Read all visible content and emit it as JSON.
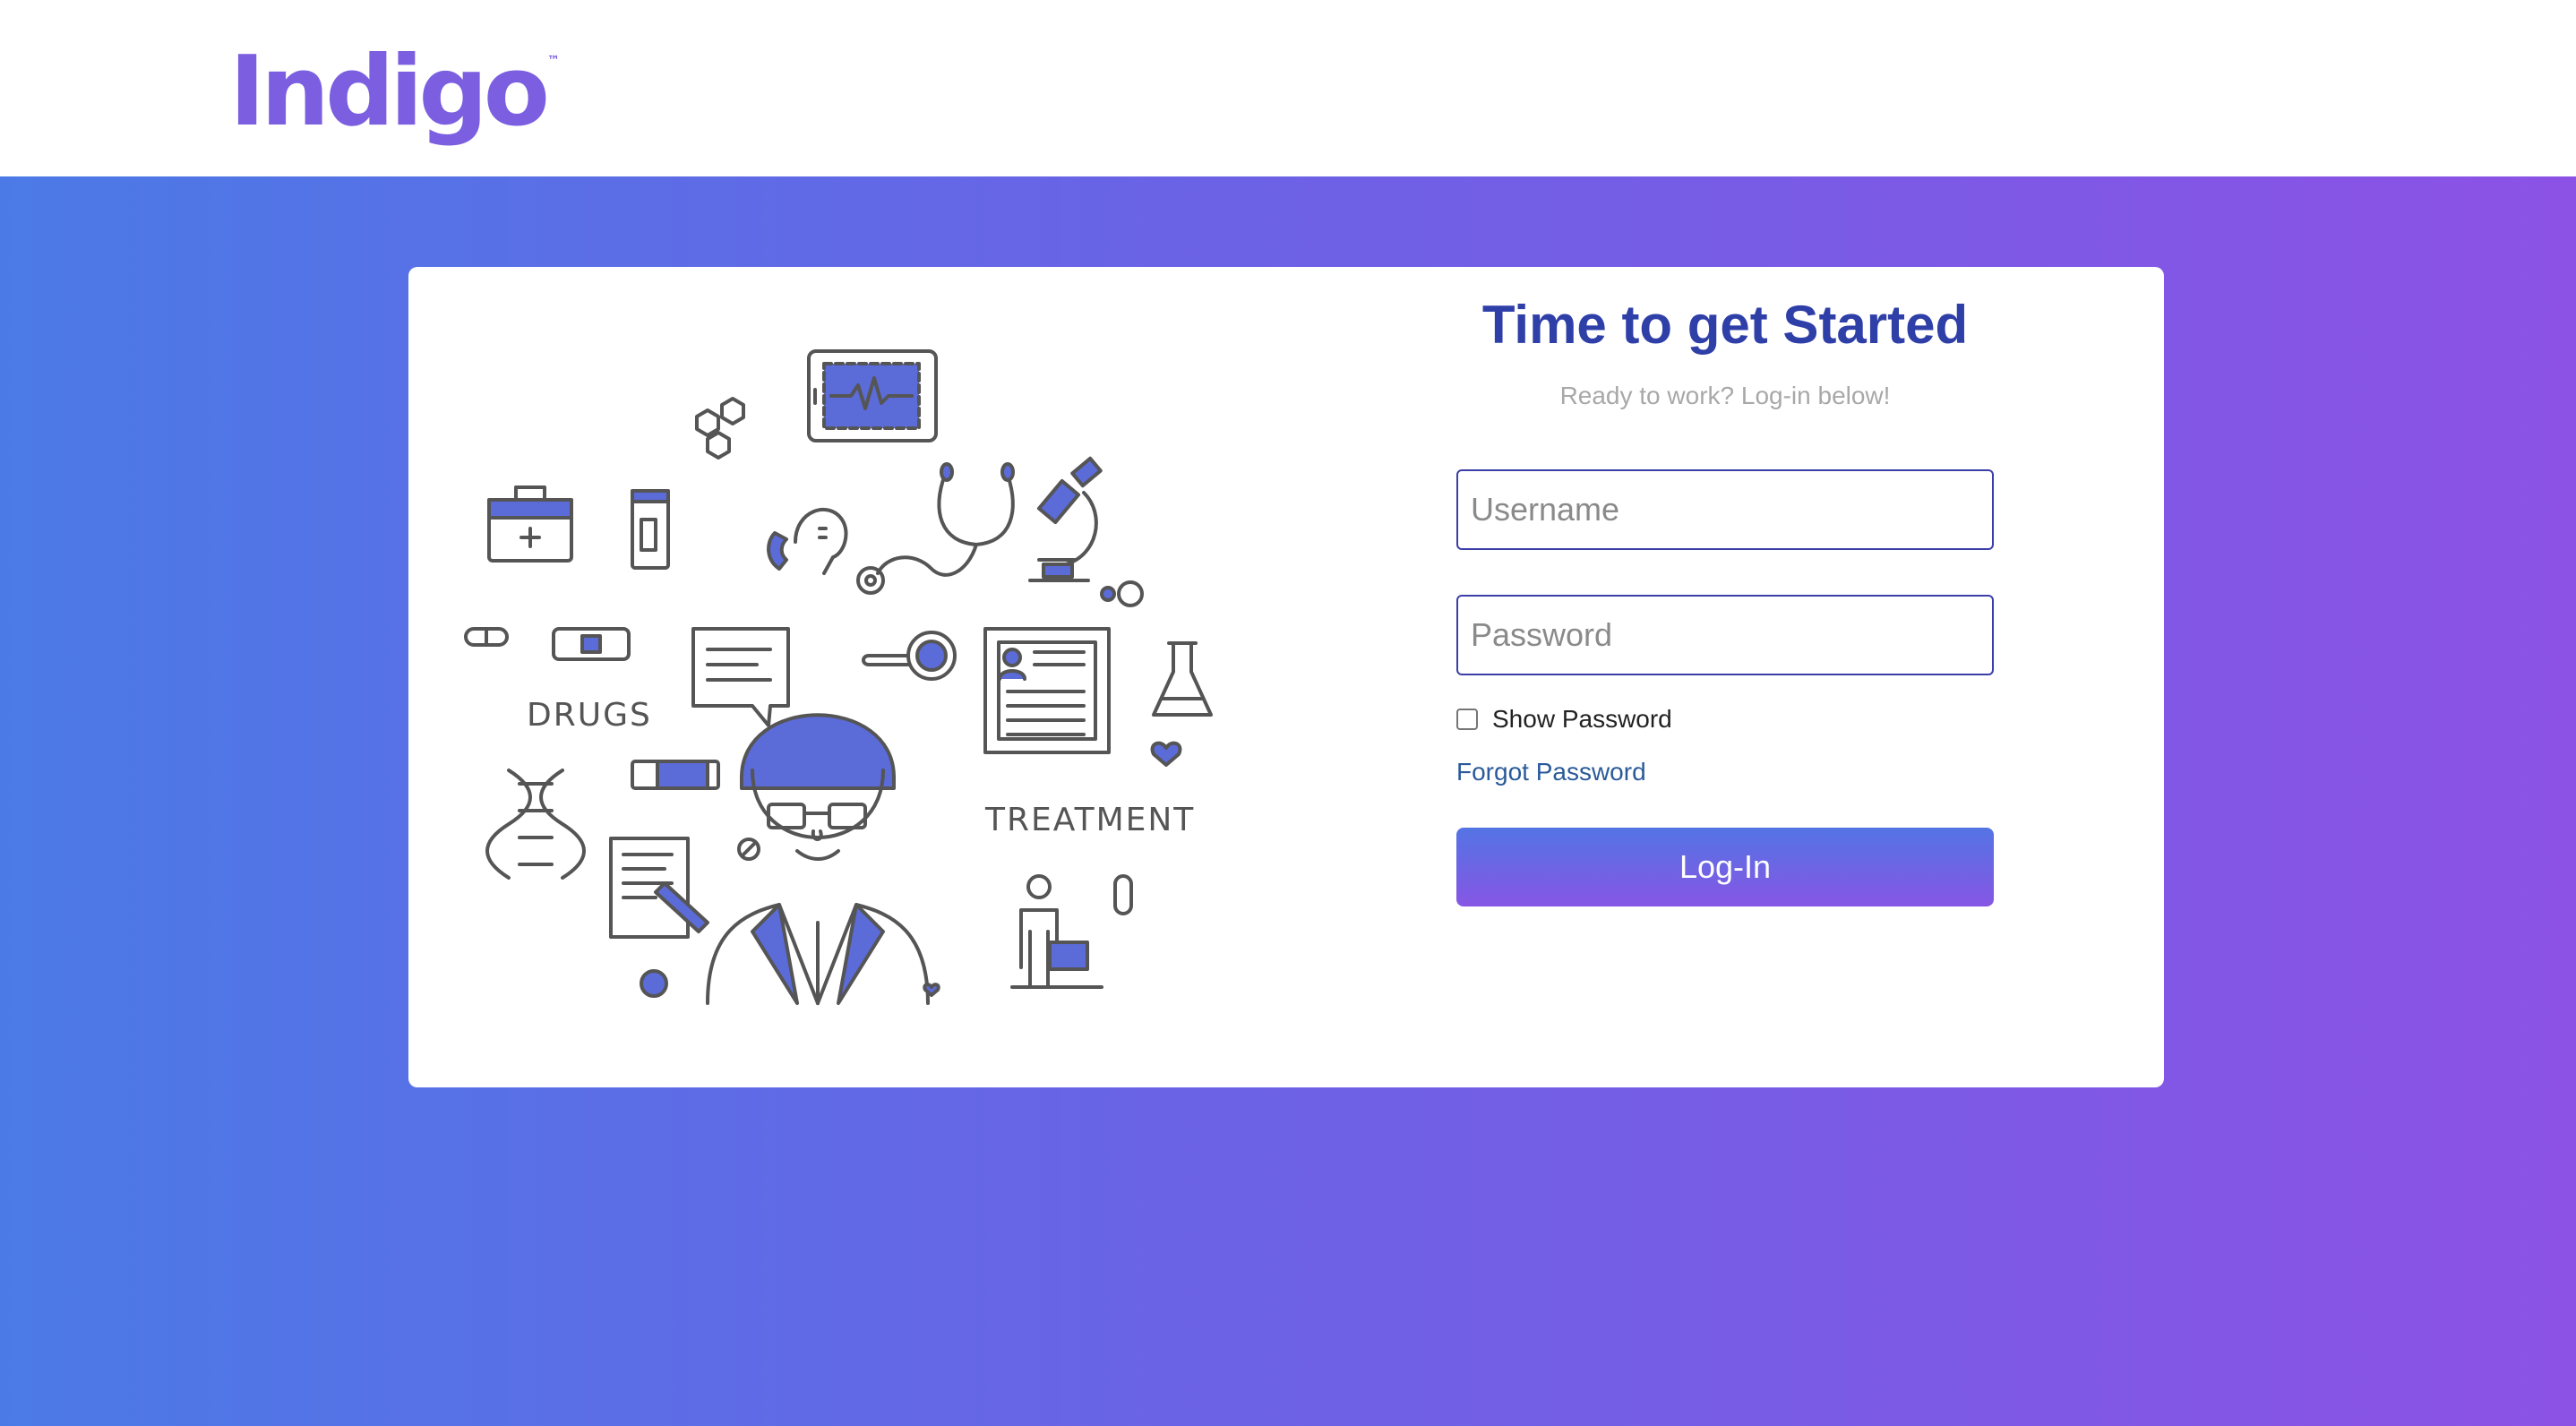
{
  "brand": {
    "name": "Indigo",
    "trademark": "™"
  },
  "login": {
    "title": "Time to get Started",
    "subtitle": "Ready to work? Log-in below!",
    "username_placeholder": "Username",
    "password_placeholder": "Password",
    "show_password_label": "Show Password",
    "show_password_checked": false,
    "forgot_password_label": "Forgot Password",
    "login_button_label": "Log-In"
  },
  "illustration": {
    "labels": {
      "drugs": "DRUGS",
      "treatment": "TREATMENT"
    }
  },
  "colors": {
    "brand": "#7b5fe0",
    "gradient_start": "#4b7ae6",
    "gradient_end": "#8c52e6",
    "title": "#2f3fa8",
    "link": "#2a5a9a",
    "illustration_accent": "#5b6bd8"
  }
}
